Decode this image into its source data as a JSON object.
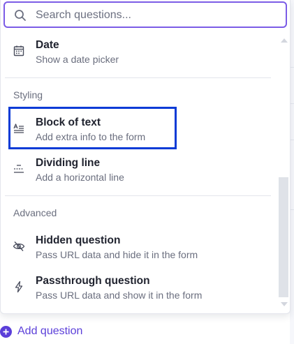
{
  "search": {
    "placeholder": "Search questions..."
  },
  "items": [
    {
      "title": "Date",
      "desc": "Show a date picker",
      "icon": "calendar-icon"
    },
    {
      "title": "Block of text",
      "desc": "Add extra info to the form",
      "icon": "text-block-icon"
    },
    {
      "title": "Dividing line",
      "desc": "Add a horizontal line",
      "icon": "dividing-line-icon"
    },
    {
      "title": "Hidden question",
      "desc": "Pass URL data and hide it in the form",
      "icon": "eye-off-icon"
    },
    {
      "title": "Passthrough question",
      "desc": "Pass URL data and show it in the form",
      "icon": "lightning-icon"
    }
  ],
  "sections": {
    "styling": "Styling",
    "advanced": "Advanced"
  },
  "footer": {
    "add_question_label": "Add question"
  },
  "colors": {
    "accent": "#5b3fd9",
    "search_border": "#7b5ce6",
    "highlight_border": "#0a3bd6"
  }
}
